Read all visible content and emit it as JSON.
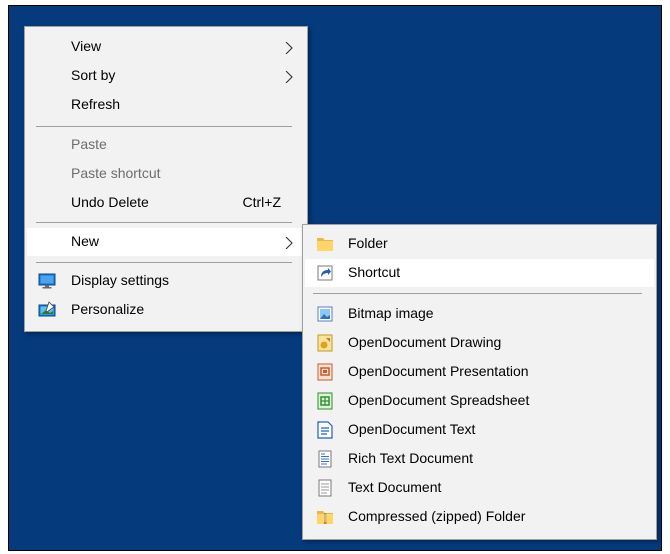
{
  "context_menu": {
    "view_label": "View",
    "sort_by_label": "Sort by",
    "refresh_label": "Refresh",
    "paste_label": "Paste",
    "paste_shortcut_label": "Paste shortcut",
    "undo_delete_label": "Undo Delete",
    "undo_delete_shortcut": "Ctrl+Z",
    "new_label": "New",
    "display_settings_label": "Display settings",
    "personalize_label": "Personalize"
  },
  "new_submenu": {
    "items": [
      {
        "label": "Folder",
        "icon": "folder-icon"
      },
      {
        "label": "Shortcut",
        "icon": "shortcut-icon"
      },
      {
        "label": "Bitmap image",
        "icon": "bitmap-image-icon"
      },
      {
        "label": "OpenDocument Drawing",
        "icon": "odg-icon"
      },
      {
        "label": "OpenDocument Presentation",
        "icon": "odp-icon"
      },
      {
        "label": "OpenDocument Spreadsheet",
        "icon": "ods-icon"
      },
      {
        "label": "OpenDocument Text",
        "icon": "odt-icon"
      },
      {
        "label": "Rich Text Document",
        "icon": "rtf-icon"
      },
      {
        "label": "Text Document",
        "icon": "text-document-icon"
      },
      {
        "label": "Compressed (zipped) Folder",
        "icon": "zip-folder-icon"
      }
    ]
  },
  "colors": {
    "desktop_background": "#053a7d",
    "menu_background": "#f2f2f2",
    "hover_background": "#ffffff",
    "disabled_text": "#6d6d6d"
  }
}
